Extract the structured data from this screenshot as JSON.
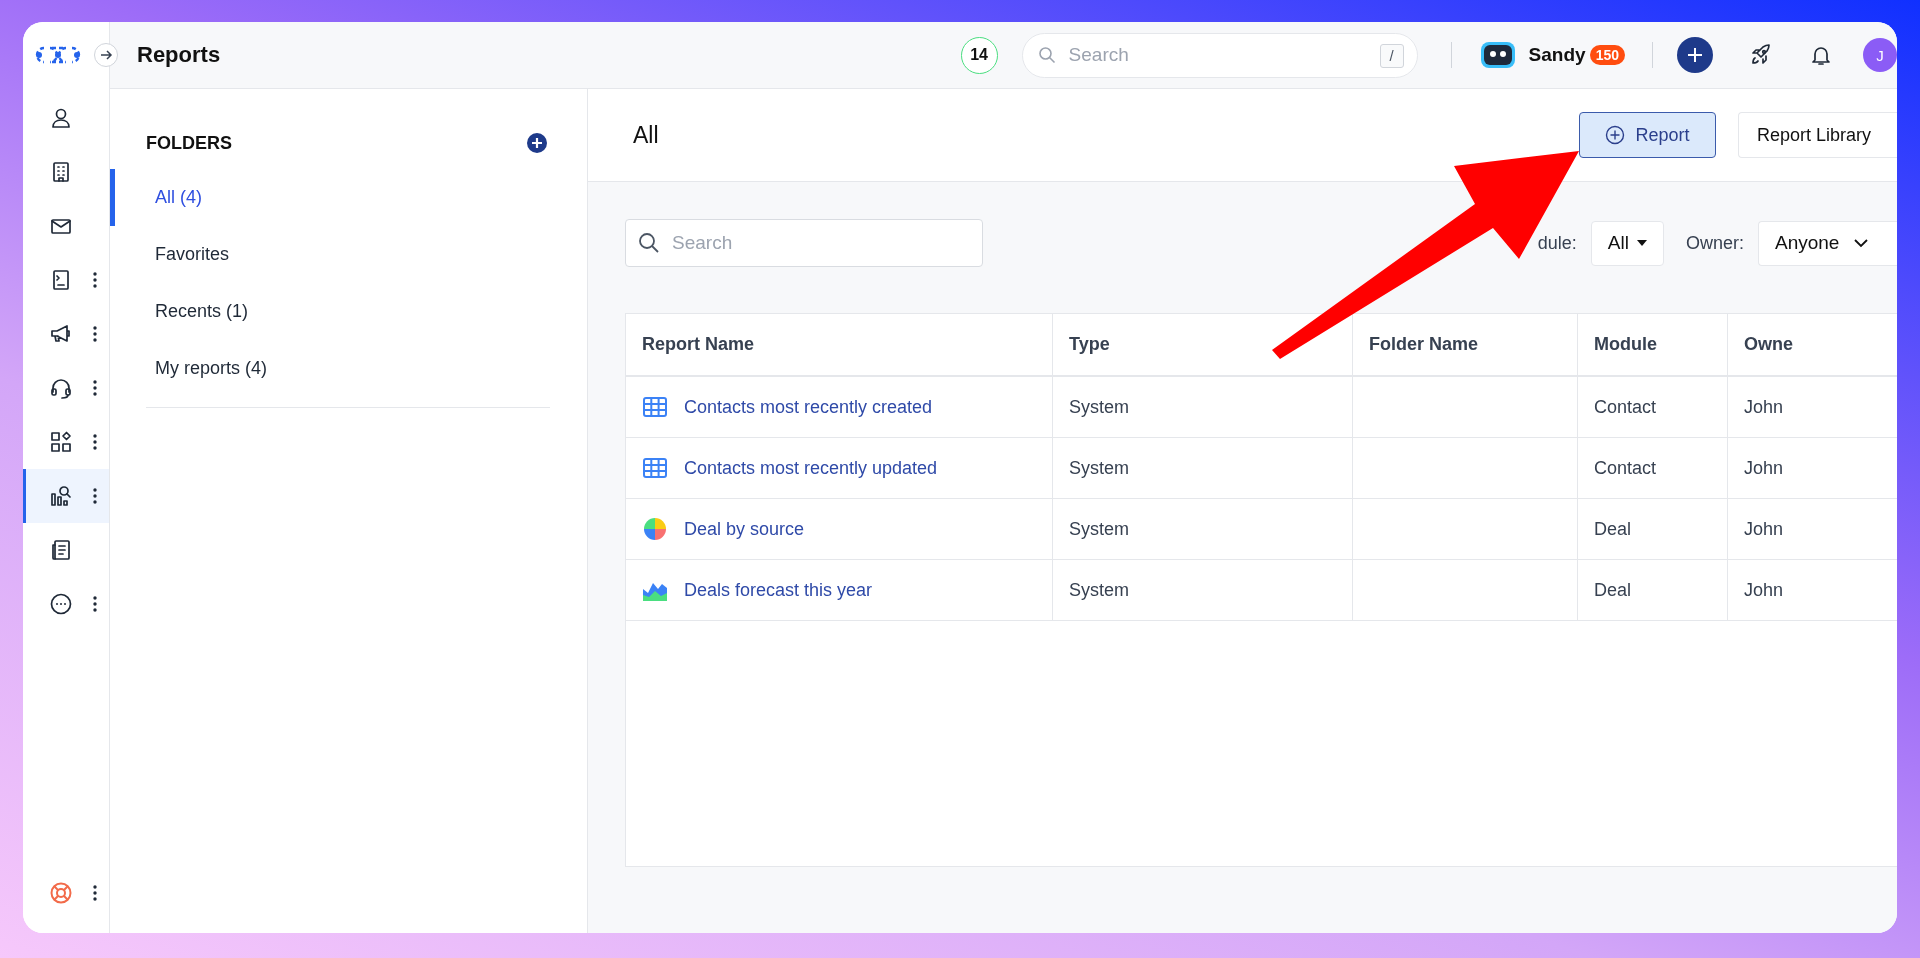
{
  "window": {
    "title": "Reports"
  },
  "rail": {
    "items": [
      {
        "selected": false,
        "has_menu": false
      },
      {
        "selected": false,
        "has_menu": false
      },
      {
        "selected": false,
        "has_menu": false
      },
      {
        "selected": false,
        "has_menu": true
      },
      {
        "selected": false,
        "has_menu": true
      },
      {
        "selected": false,
        "has_menu": true
      },
      {
        "selected": false,
        "has_menu": true
      },
      {
        "selected": true,
        "has_menu": true
      },
      {
        "selected": false,
        "has_menu": false
      },
      {
        "selected": false,
        "has_menu": true
      }
    ],
    "footer_item": {
      "has_menu": true
    }
  },
  "top_bar": {
    "count": "14",
    "search": {
      "placeholder": "Search",
      "shortcut": "/"
    },
    "user": {
      "name": "Sandy",
      "badge": "150"
    },
    "avatar": "J"
  },
  "folders": {
    "title": "FOLDERS",
    "items": [
      {
        "label": "All (4)",
        "selected": true
      },
      {
        "label": "Favorites",
        "selected": false
      },
      {
        "label": "Recents (1)",
        "selected": false
      },
      {
        "label": "My reports (4)",
        "selected": false
      }
    ]
  },
  "main": {
    "title": "All",
    "buttons": [
      {
        "label": "Report",
        "kind": "primary"
      },
      {
        "label": "Report Library",
        "kind": "secondary"
      }
    ],
    "search": {
      "placeholder": "Search"
    },
    "filters": [
      {
        "label": "dule:",
        "value": "All",
        "kind": "caret"
      },
      {
        "label": "Owner:",
        "value": "Anyone",
        "kind": "chevron"
      }
    ],
    "table": {
      "columns": [
        "Report Name",
        "Type",
        "Folder Name",
        "Module",
        "Owne"
      ],
      "rows": [
        {
          "kind": "grid",
          "name": "Contacts most recently created",
          "type": "System",
          "module": "Contact",
          "owner": "John"
        },
        {
          "kind": "grid",
          "name": "Contacts most recently updated",
          "type": "System",
          "module": "Contact",
          "owner": "John"
        },
        {
          "kind": "pie",
          "name": "Deal by source",
          "type": "System",
          "module": "Deal",
          "owner": "John"
        },
        {
          "kind": "area",
          "name": "Deals forecast this year",
          "type": "System",
          "module": "Deal",
          "owner": "John"
        }
      ]
    }
  }
}
